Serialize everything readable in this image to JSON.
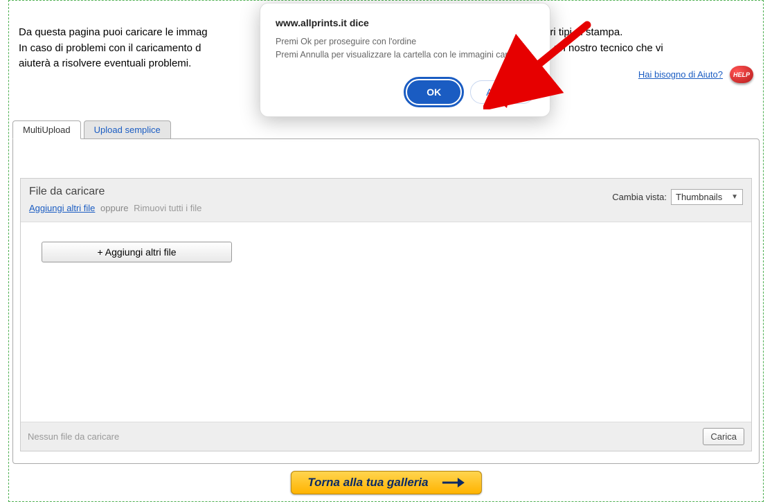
{
  "intro": {
    "line1_before": "Da questa pagina puoi caricare le immag",
    "line1_after": "a i vari tipi di stampa.",
    "line2_before": "In caso di problemi con il caricamento d",
    "line2_after": "onderà un nostro tecnico che vi",
    "line3": "aiuterà a risolvere eventuali problemi."
  },
  "help": {
    "link": "Hai bisogno di Aiuto?",
    "badge": "HELP"
  },
  "tabs": {
    "multi": "MultiUpload",
    "simple": "Upload semplice"
  },
  "uploader": {
    "title": "File da caricare",
    "add_link": "Aggiungi altri file",
    "separator": "oppure",
    "remove_link": "Rimuovi tutti i file",
    "view_label": "Cambia vista:",
    "view_value": "Thumbnails",
    "add_button": "+ Aggiungi altri file",
    "no_files": "Nessun file da caricare",
    "load_button": "Carica"
  },
  "gallery_button": "Torna alla tua galleria",
  "dialog": {
    "title": "www.allprints.it dice",
    "line1": "Premi Ok per proseguire con l'ordine",
    "line2": "Premi Annulla per visualizzare la cartella con le immagini caricate",
    "ok": "OK",
    "cancel": "Annulla"
  }
}
